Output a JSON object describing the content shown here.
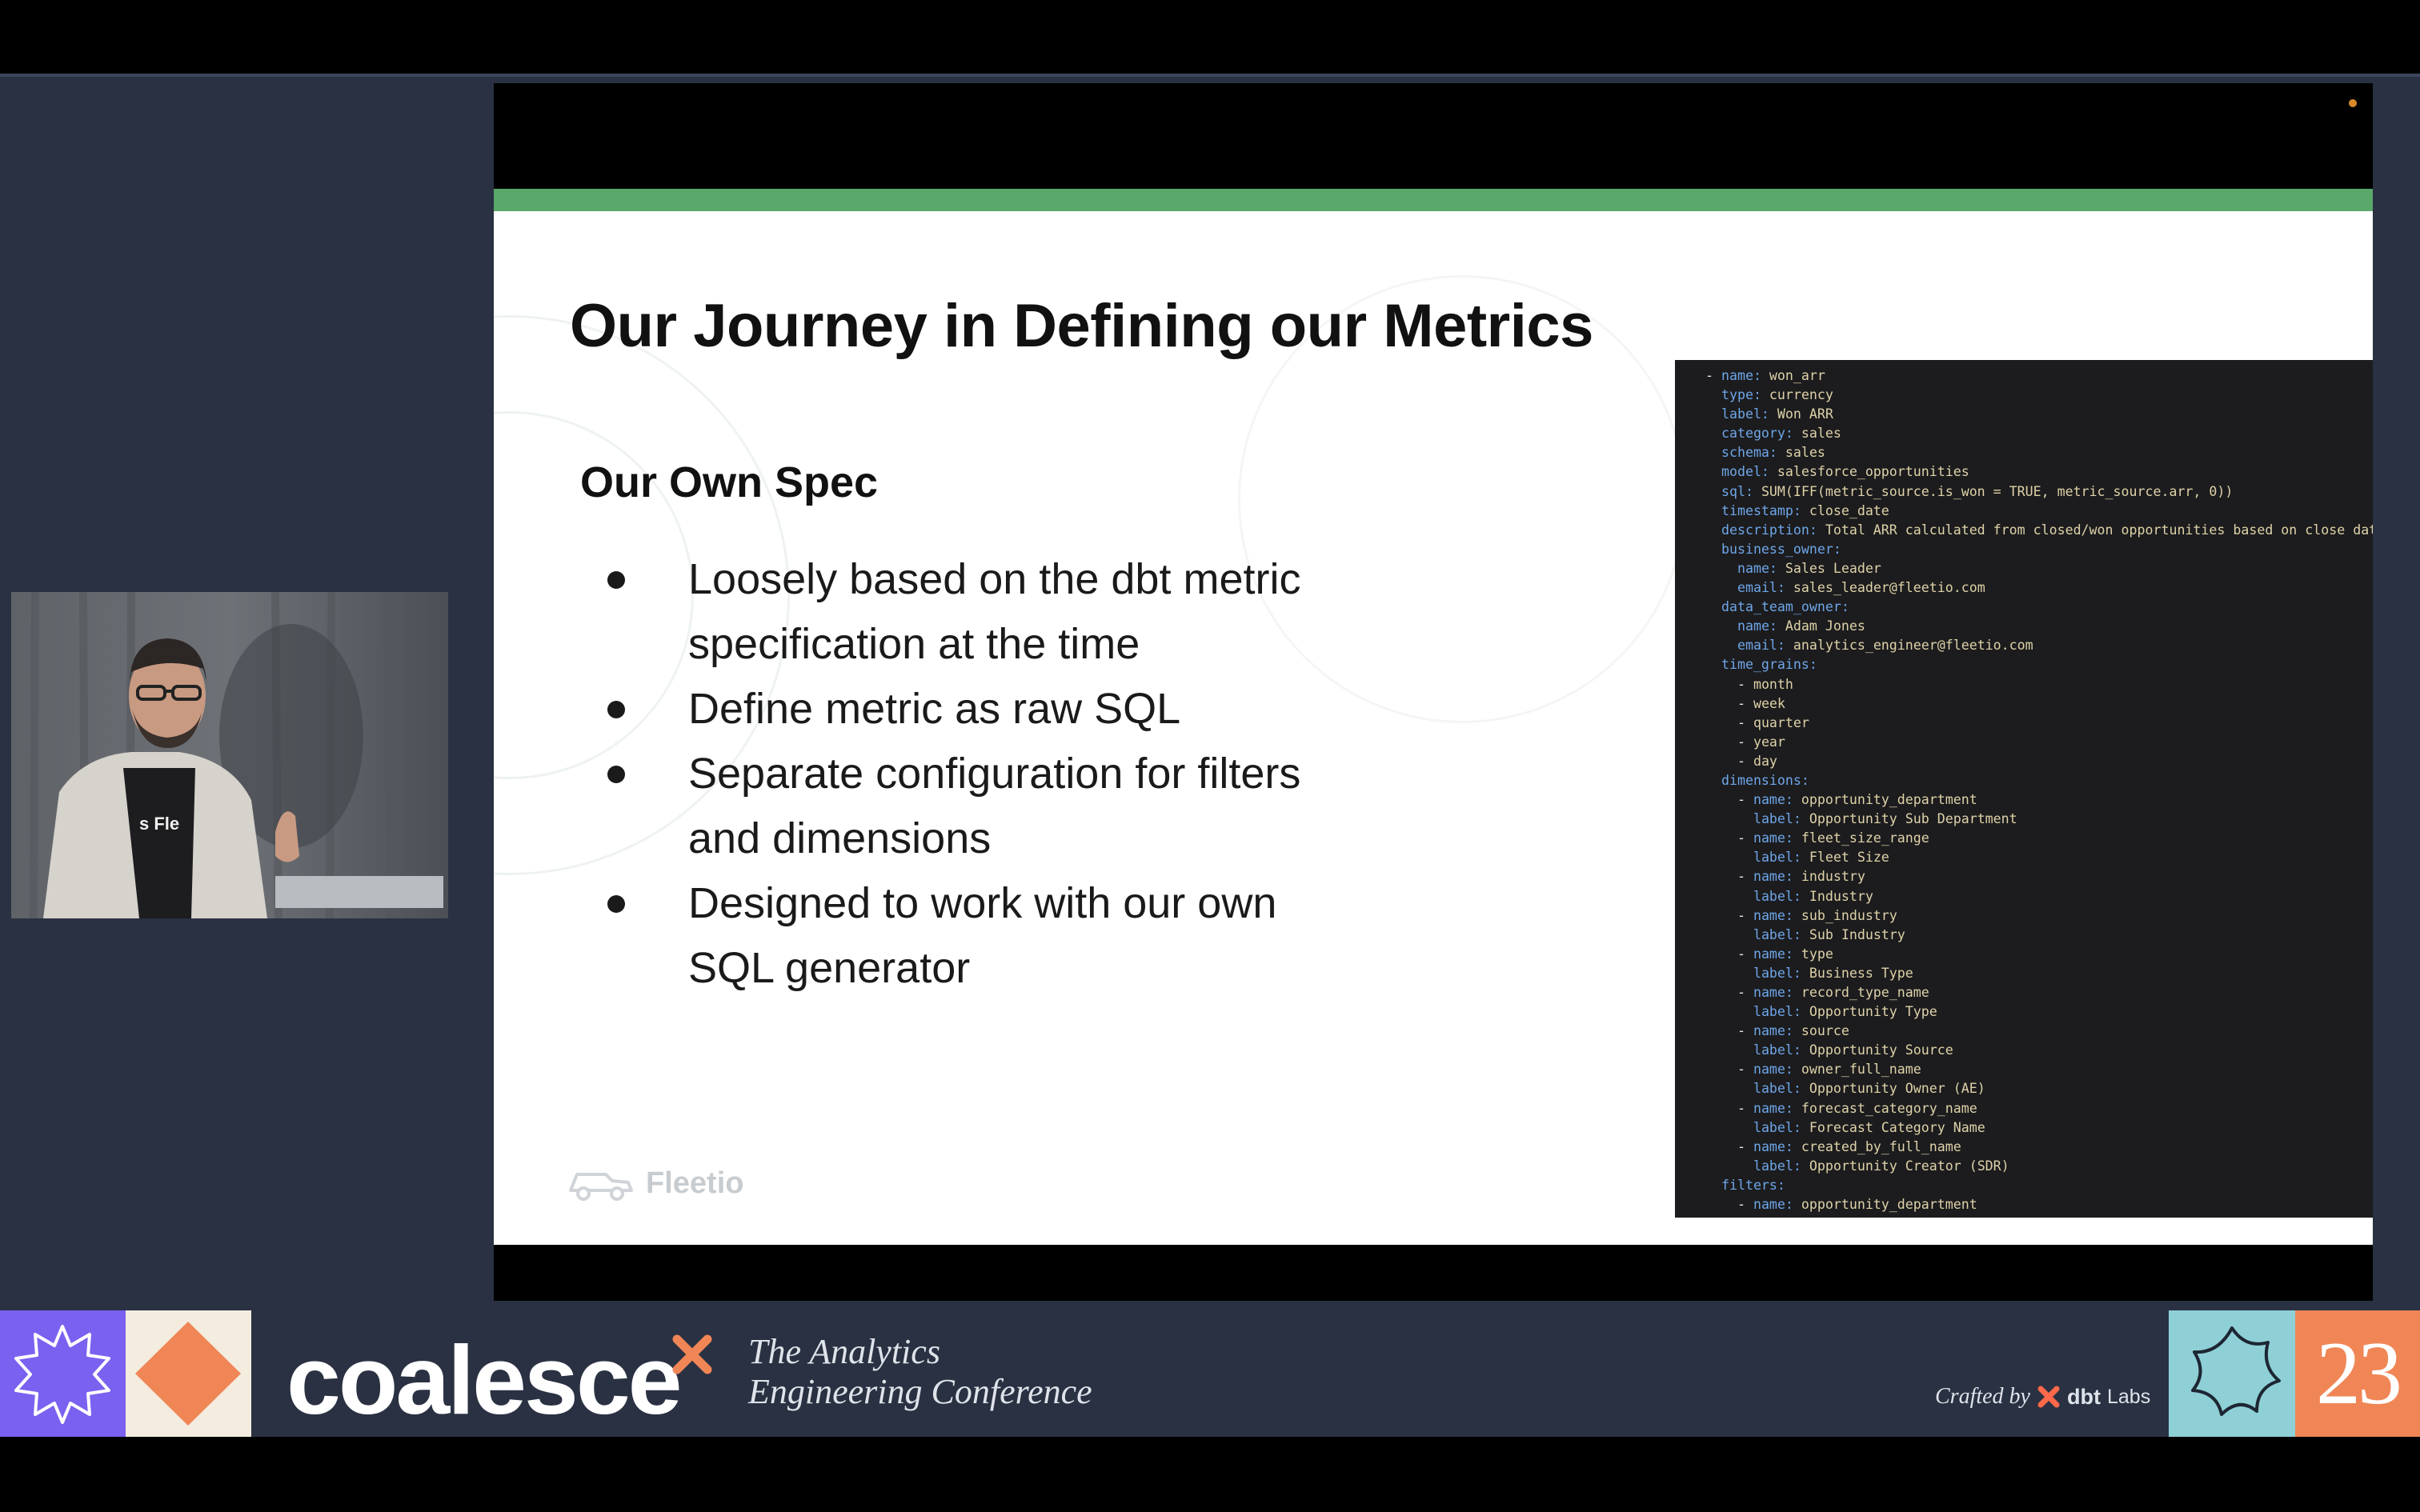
{
  "slide": {
    "title": "Our Journey in Defining our Metrics",
    "section_heading": "Our Own Spec",
    "bullets": [
      "Loosely based on the dbt metric specification at the time",
      "Define metric as raw SQL",
      "Separate configuration for filters and dimensions",
      "Designed to work with our own SQL generator"
    ],
    "logo_text": "Fleetio"
  },
  "code_snippet": {
    "lines": [
      [
        "- ",
        "name",
        "won_arr"
      ],
      [
        "  ",
        "type",
        "currency"
      ],
      [
        "  ",
        "label",
        "Won ARR"
      ],
      [
        "  ",
        "category",
        "sales"
      ],
      [
        "  ",
        "schema",
        "sales"
      ],
      [
        "  ",
        "model",
        "salesforce_opportunities"
      ],
      [
        "  ",
        "sql",
        "SUM(IFF(metric_source.is_won = TRUE, metric_source.arr, 0))"
      ],
      [
        "  ",
        "timestamp",
        "close_date"
      ],
      [
        "  ",
        "description",
        "Total ARR calculated from closed/won opportunities based on close date"
      ],
      [
        "  ",
        "business_owner",
        ""
      ],
      [
        "    ",
        "name",
        "Sales Leader"
      ],
      [
        "    ",
        "email",
        "sales_leader@fleetio.com"
      ],
      [
        "  ",
        "data_team_owner",
        ""
      ],
      [
        "    ",
        "name",
        "Adam Jones"
      ],
      [
        "    ",
        "email",
        "analytics_engineer@fleetio.com"
      ],
      [
        "  ",
        "time_grains",
        ""
      ],
      [
        "    - ",
        "",
        "month"
      ],
      [
        "    - ",
        "",
        "week"
      ],
      [
        "    - ",
        "",
        "quarter"
      ],
      [
        "    - ",
        "",
        "year"
      ],
      [
        "    - ",
        "",
        "day"
      ],
      [
        "  ",
        "dimensions",
        ""
      ],
      [
        "    - ",
        "name",
        "opportunity_department"
      ],
      [
        "      ",
        "label",
        "Opportunity Sub Department"
      ],
      [
        "    - ",
        "name",
        "fleet_size_range"
      ],
      [
        "      ",
        "label",
        "Fleet Size"
      ],
      [
        "    - ",
        "name",
        "industry"
      ],
      [
        "      ",
        "label",
        "Industry"
      ],
      [
        "    - ",
        "name",
        "sub_industry"
      ],
      [
        "      ",
        "label",
        "Sub Industry"
      ],
      [
        "    - ",
        "name",
        "type"
      ],
      [
        "      ",
        "label",
        "Business Type"
      ],
      [
        "    - ",
        "name",
        "record_type_name"
      ],
      [
        "      ",
        "label",
        "Opportunity Type"
      ],
      [
        "    - ",
        "name",
        "source"
      ],
      [
        "      ",
        "label",
        "Opportunity Source"
      ],
      [
        "    - ",
        "name",
        "owner_full_name"
      ],
      [
        "      ",
        "label",
        "Opportunity Owner (AE)"
      ],
      [
        "    - ",
        "name",
        "forecast_category_name"
      ],
      [
        "      ",
        "label",
        "Forecast Category Name"
      ],
      [
        "    - ",
        "name",
        "created_by_full_name"
      ],
      [
        "      ",
        "label",
        "Opportunity Creator (SDR)"
      ],
      [
        "  ",
        "filters",
        ""
      ],
      [
        "    - ",
        "name",
        "opportunity_department"
      ]
    ]
  },
  "webcam": {
    "shirt_text": "s Fle"
  },
  "banner": {
    "brand": "coalesce",
    "tagline_line1": "The Analytics",
    "tagline_line2": "Engineering Conference",
    "crafted_by": "Crafted by",
    "sponsor": "dbt",
    "sponsor_suffix": "Labs",
    "year": "23"
  },
  "colors": {
    "stage_bg": "#2a3142",
    "slide_accent_green": "#5aa86a",
    "code_bg": "#1c1c1e",
    "code_key": "#6ea6e8",
    "code_value": "#ded2a8",
    "tile_purple": "#7b61f0",
    "tile_cream": "#f3ecdf",
    "tile_orange": "#f08656",
    "tile_teal": "#8ed0d6",
    "dbt_orange": "#ff694a"
  }
}
